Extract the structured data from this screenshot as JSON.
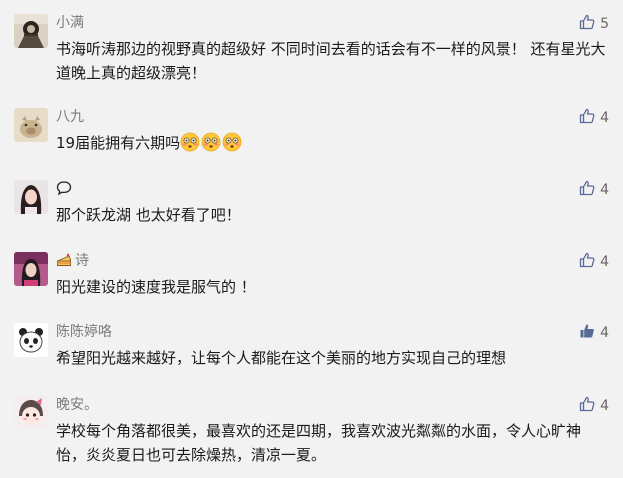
{
  "colors": {
    "background": "#f2f2f2",
    "name": "#7b7b7b",
    "text": "#1a1a1a",
    "like_outline": "#576b95",
    "like_filled": "#576b95"
  },
  "comments": [
    {
      "author": "小满",
      "text": "书海听涛那边的视野真的超级好  不同时间去看的话会有不一样的风景！ 还有星光大道晚上真的超级漂亮！",
      "likes": "5",
      "liked": false,
      "avatar_icon": "avatar-ink-portrait"
    },
    {
      "author": "八九",
      "text": "19届能拥有六期吗",
      "emoji": [
        "flushed-face-emoji",
        "flushed-face-emoji",
        "flushed-face-emoji"
      ],
      "likes": "4",
      "liked": false,
      "avatar_icon": "avatar-cartoon-pig"
    },
    {
      "author": "",
      "name_icon": "speech-bubble-icon",
      "text": "那个跃龙湖 也太好看了吧！",
      "likes": "4",
      "liked": false,
      "avatar_icon": "avatar-girl-photo"
    },
    {
      "author": "诗",
      "name_icon": "cake-icon",
      "text": "阳光建设的速度我是服气的 ！",
      "likes": "4",
      "liked": false,
      "avatar_icon": "avatar-woman-pink"
    },
    {
      "author": "陈陈婷咯",
      "text": "希望阳光越来越好，让每个人都能在这个美丽的地方实现自己的理想",
      "likes": "4",
      "liked": true,
      "avatar_icon": "avatar-cartoon-panda"
    },
    {
      "author": "晚安。",
      "text": "学校每个角落都很美，最喜欢的还是四期，我喜欢波光粼粼的水面，令人心旷神怡，炎炎夏日也可去除燥热，清凉一夏。",
      "likes": "4",
      "liked": false,
      "avatar_icon": "avatar-cartoon-girl"
    }
  ]
}
